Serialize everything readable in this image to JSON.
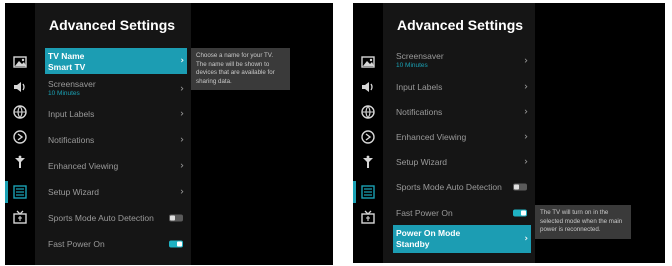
{
  "left": {
    "title": "Advanced Settings",
    "items": [
      {
        "label": "TV Name",
        "sublabel": "Smart TV"
      },
      {
        "label": "Screensaver",
        "sublabel": "10 Minutes"
      },
      {
        "label": "Input Labels"
      },
      {
        "label": "Notifications"
      },
      {
        "label": "Enhanced Viewing"
      },
      {
        "label": "Setup Wizard"
      },
      {
        "label": "Sports Mode Auto Detection",
        "toggle": "off"
      },
      {
        "label": "Fast Power On",
        "toggle": "on"
      }
    ],
    "tooltip": "Choose a name for your TV. The name will be shown to devices that are available for sharing data."
  },
  "right": {
    "title": "Advanced Settings",
    "items": [
      {
        "label": "Screensaver",
        "sublabel": "10 Minutes"
      },
      {
        "label": "Input Labels"
      },
      {
        "label": "Notifications"
      },
      {
        "label": "Enhanced Viewing"
      },
      {
        "label": "Setup Wizard"
      },
      {
        "label": "Sports Mode Auto Detection",
        "toggle": "off"
      },
      {
        "label": "Fast Power On",
        "toggle": "on"
      },
      {
        "label": "Power On Mode",
        "sublabel": "Standby"
      }
    ],
    "tooltip": "The TV will turn on in the selected mode when the main power is reconnected."
  },
  "icons": [
    "picture-icon",
    "sound-icon",
    "network-icon",
    "accessibility-icon",
    "general-icon",
    "advanced-settings-icon",
    "tv-icon"
  ],
  "colors": {
    "accent": "#1c9db3",
    "panel": "#151515",
    "background": "#000000",
    "tooltip": "#3a3a3a"
  }
}
